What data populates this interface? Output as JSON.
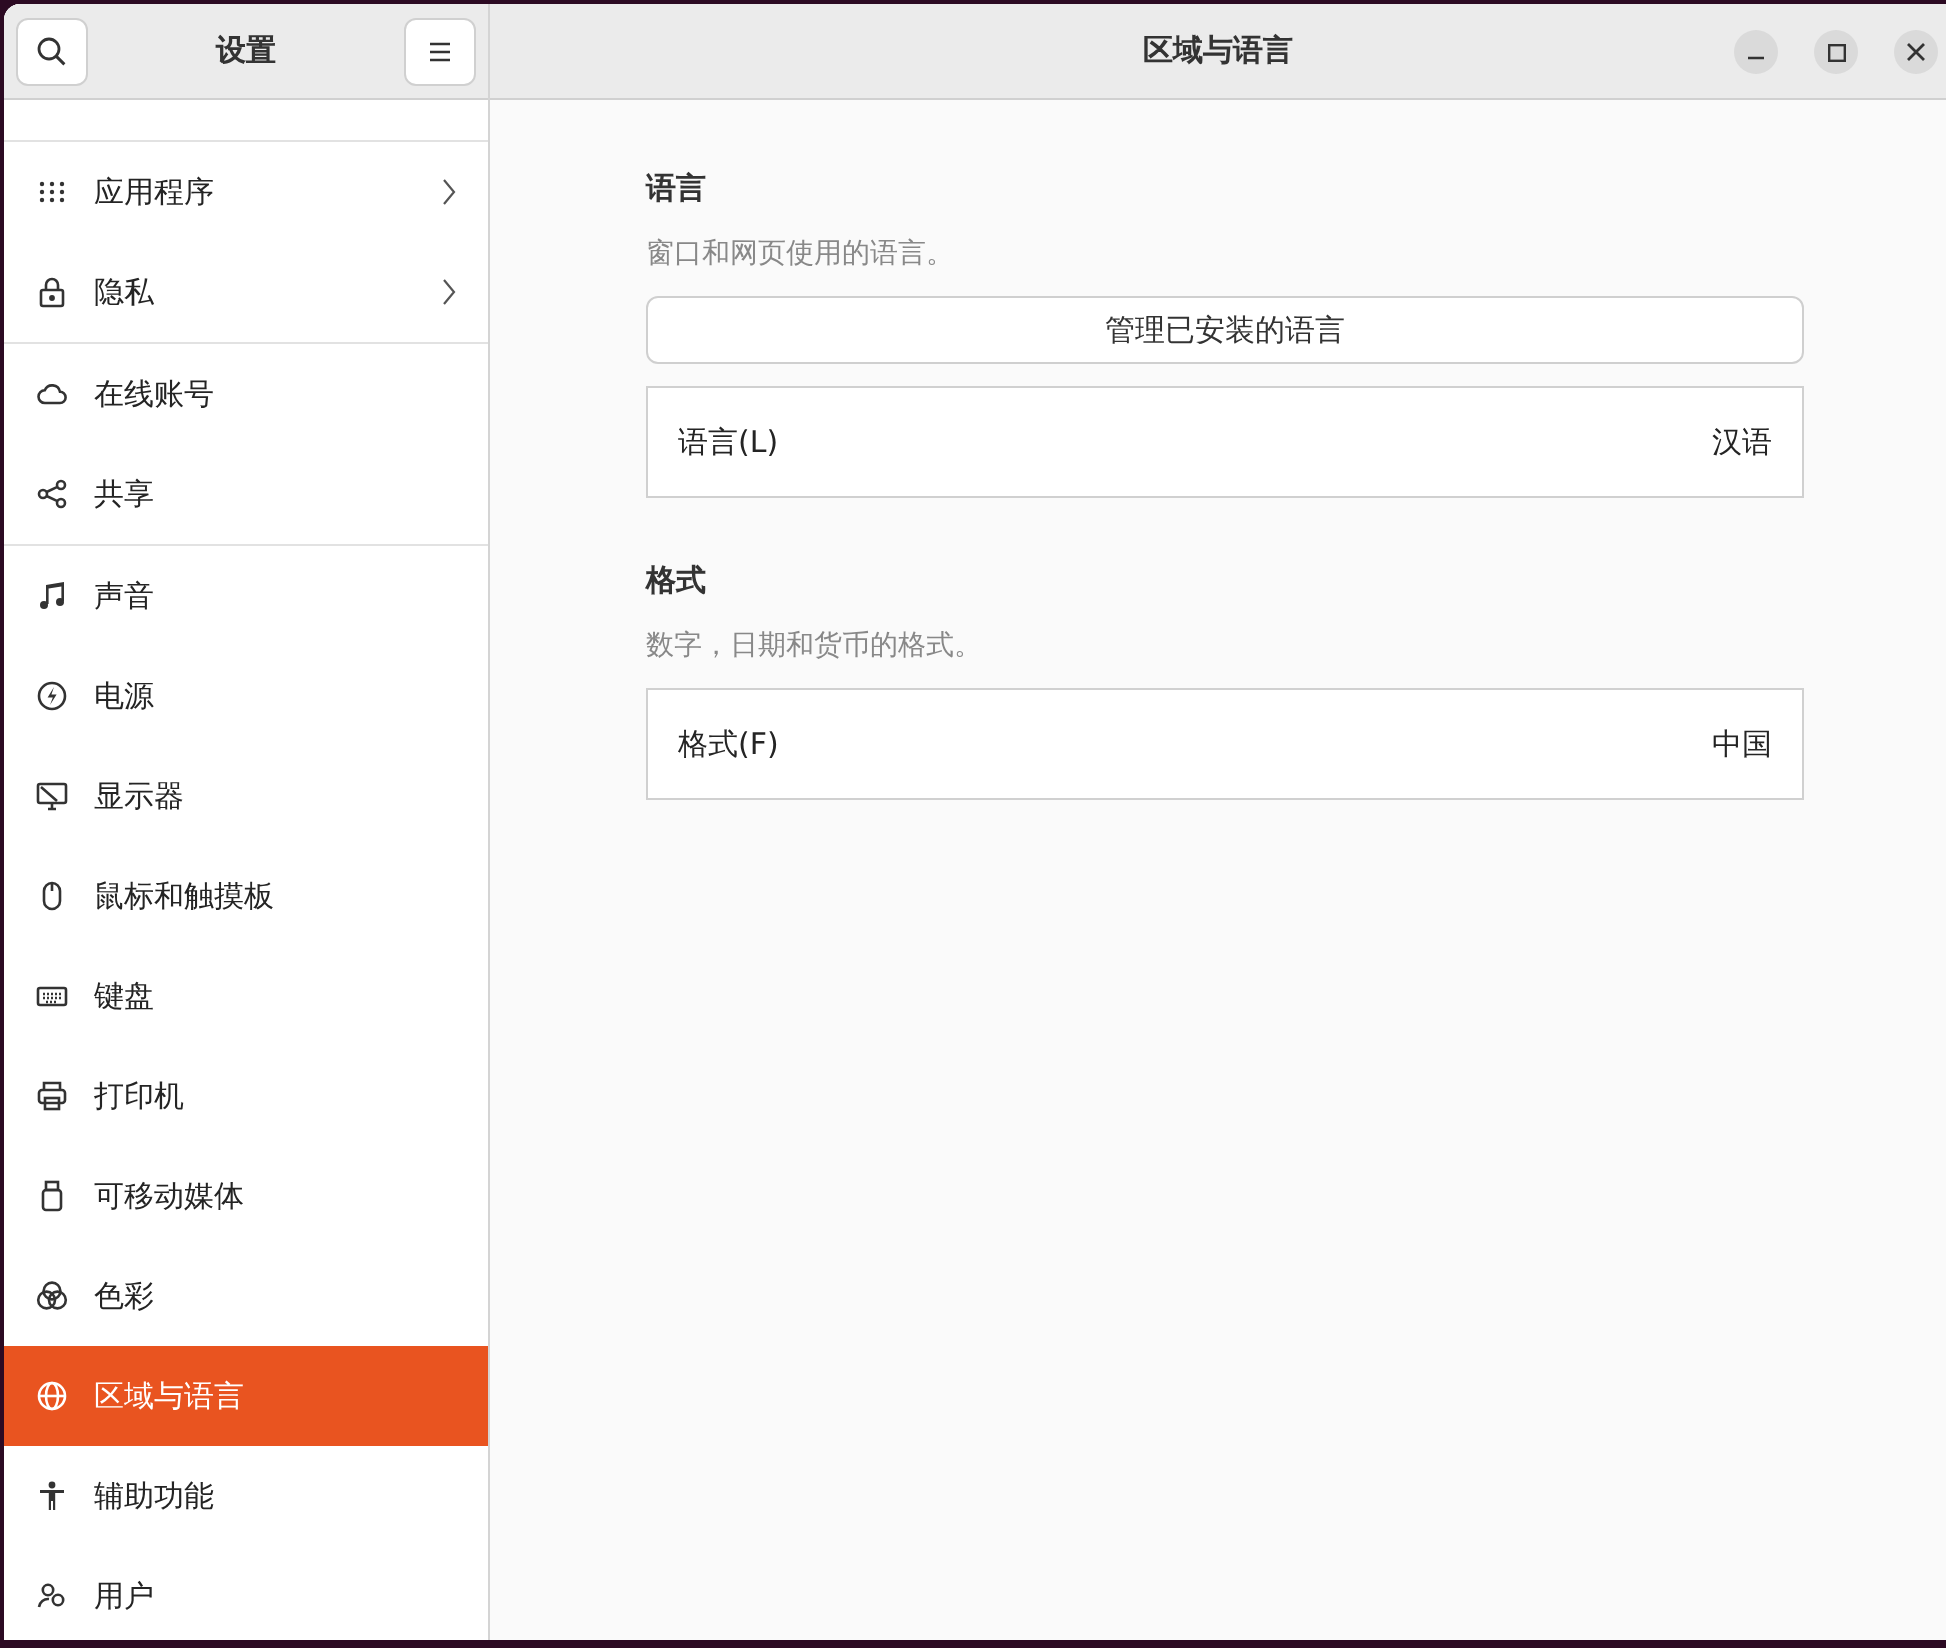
{
  "sidebar": {
    "title": "设置",
    "groups": [
      {
        "items": [
          {
            "label": "应用程序",
            "submenu": true,
            "selected": false
          },
          {
            "label": "隐私",
            "submenu": true,
            "selected": false
          }
        ]
      },
      {
        "items": [
          {
            "label": "在线账号",
            "submenu": false,
            "selected": false
          },
          {
            "label": "共享",
            "submenu": false,
            "selected": false
          }
        ]
      },
      {
        "items": [
          {
            "label": "声音",
            "submenu": false,
            "selected": false
          },
          {
            "label": "电源",
            "submenu": false,
            "selected": false
          },
          {
            "label": "显示器",
            "submenu": false,
            "selected": false
          },
          {
            "label": "鼠标和触摸板",
            "submenu": false,
            "selected": false
          },
          {
            "label": "键盘",
            "submenu": false,
            "selected": false
          },
          {
            "label": "打印机",
            "submenu": false,
            "selected": false
          },
          {
            "label": "可移动媒体",
            "submenu": false,
            "selected": false
          },
          {
            "label": "色彩",
            "submenu": false,
            "selected": false
          },
          {
            "label": "区域与语言",
            "submenu": false,
            "selected": true
          },
          {
            "label": "辅助功能",
            "submenu": false,
            "selected": false
          },
          {
            "label": "用户",
            "submenu": false,
            "selected": false
          }
        ]
      }
    ]
  },
  "header": {
    "title": "区域与语言"
  },
  "sections": [
    {
      "heading": "语言",
      "description": "窗口和网页使用的语言。",
      "button": "管理已安装的语言",
      "rows": [
        {
          "label": "语言(L)",
          "value": "汉语"
        }
      ]
    },
    {
      "heading": "格式",
      "description": "数字，日期和货币的格式。",
      "rows": [
        {
          "label": "格式(F)",
          "value": "中国"
        }
      ]
    }
  ]
}
